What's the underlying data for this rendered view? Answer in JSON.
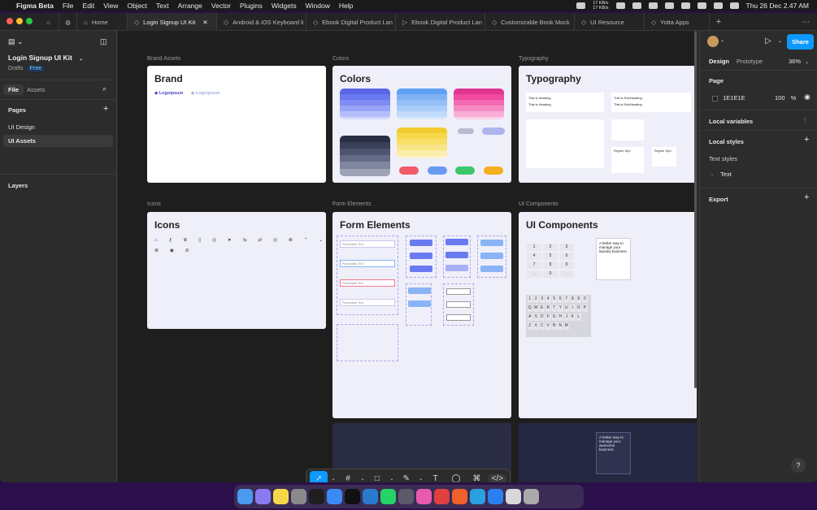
{
  "menubar": {
    "app": "Figma Beta",
    "items": [
      "File",
      "Edit",
      "View",
      "Object",
      "Text",
      "Arrange",
      "Vector",
      "Plugins",
      "Widgets",
      "Window",
      "Help"
    ],
    "net_up": "17 KB/s",
    "net_down": "17 KB/s",
    "datetime": "Thu 26 Dec  2.47 AM"
  },
  "tabs": [
    {
      "label": "Home",
      "icon": "home-icon"
    },
    {
      "label": "Login Signup UI Kit",
      "icon": "figma-file-icon"
    },
    {
      "label": "Android & iOS Keyboard li",
      "icon": "figma-file-icon"
    },
    {
      "label": "Ebook Digital Product Lan",
      "icon": "figma-file-icon"
    },
    {
      "label": "Ebook Digital Product Lan",
      "icon": "play-icon"
    },
    {
      "label": "Customizable Book Mock",
      "icon": "figma-file-icon"
    },
    {
      "label": "UI Resource",
      "icon": "figma-file-icon"
    },
    {
      "label": "Yotta Apps",
      "icon": "figma-file-icon"
    }
  ],
  "left": {
    "file_name": "Login Signup UI Kit",
    "location": "Drafts",
    "plan": "Free",
    "tab_file": "File",
    "tab_assets": "Assets",
    "pages_heading": "Pages",
    "pages": [
      "UI Design",
      "UI Assets"
    ],
    "layers_heading": "Layers"
  },
  "canvas": {
    "labels": {
      "brand": "Brand Assets",
      "colors": "Colors",
      "typography": "Typography",
      "icons": "Icons",
      "forms": "Form Elements",
      "ui": "UI Components"
    },
    "titles": {
      "brand": "Brand",
      "colors": "Colors",
      "typography": "Typography",
      "icons": "Icons",
      "forms": "Form Elements",
      "ui": "UI Components"
    },
    "logo_text": "Logoipsum",
    "heading_sample": "This is Heading",
    "subheading_sample": "This is SubHeading",
    "regular_sample": "Regular 16px",
    "button_text": "Button Text",
    "placeholder_text": "Placeholder Text",
    "promo_text": "A better way to manage your laundry business",
    "promo_text_dark": "A better way to manage your awesome business",
    "keypad": [
      "1",
      "2",
      "3",
      "4",
      "5",
      "6",
      "7",
      "8",
      "9",
      ",",
      "0",
      "."
    ],
    "keyboard_row1": [
      "1",
      "2",
      "3",
      "4",
      "5",
      "6",
      "7",
      "8",
      "9",
      "0"
    ],
    "keyboard_row2": [
      "Q",
      "W",
      "E",
      "R",
      "T",
      "Y",
      "U",
      "I",
      "O",
      "P"
    ],
    "keyboard_row3": [
      "A",
      "S",
      "D",
      "F",
      "G",
      "H",
      "J",
      "K",
      "L"
    ],
    "keyboard_row4": [
      "Z",
      "X",
      "C",
      "V",
      "B",
      "N",
      "M"
    ]
  },
  "right": {
    "tab_design": "Design",
    "tab_prototype": "Prototype",
    "zoom": "36%",
    "share": "Share",
    "page_heading": "Page",
    "page_color": "1E1E1E",
    "page_opacity": "100",
    "page_opacity_unit": "%",
    "local_variables": "Local variables",
    "local_styles": "Local styles",
    "text_styles": "Text styles",
    "text_item": "Text",
    "export": "Export"
  },
  "colors": {
    "accent": "#0d99ff",
    "canvas": "#1e1e1e",
    "frame_bg": "#efeffa",
    "purple": "#6a7af0",
    "blue": "#7fb2f5",
    "pink": "#f04aa0",
    "dark": "#3a3f5a",
    "yellow": "#f5d84a"
  }
}
